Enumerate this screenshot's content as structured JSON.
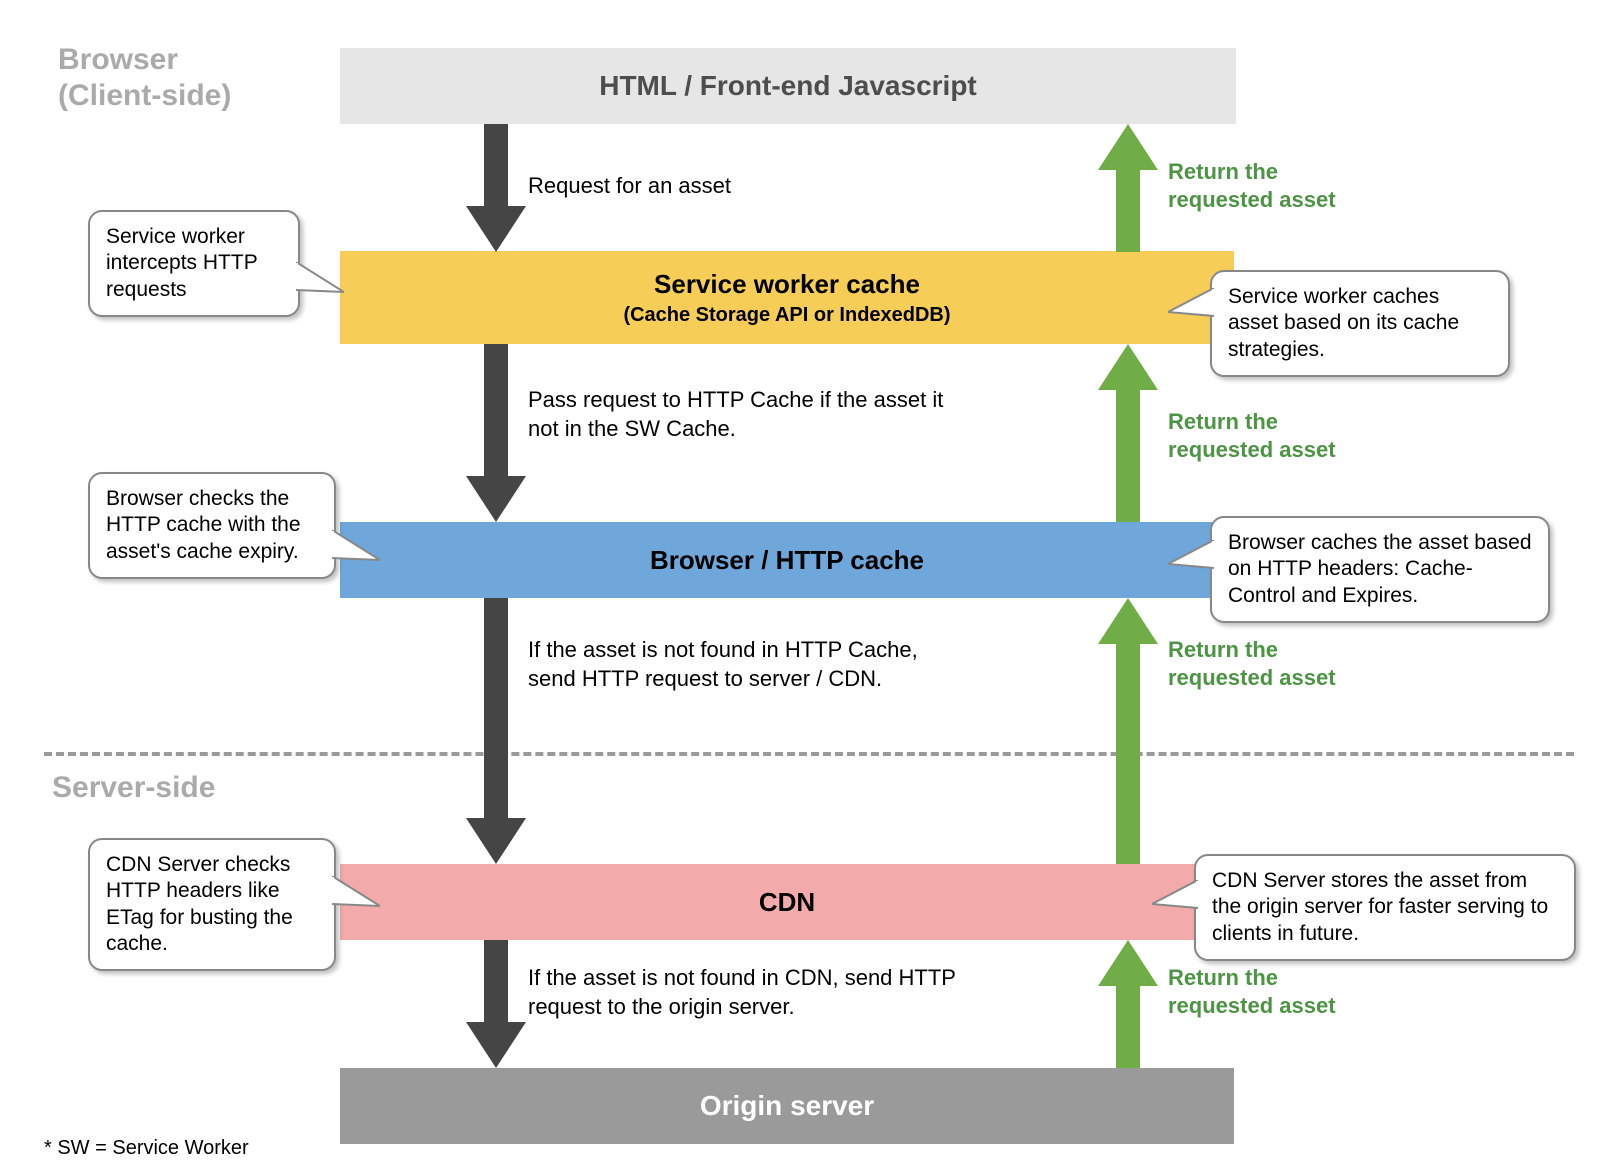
{
  "sections": {
    "browser_line1": "Browser",
    "browser_line2": "(Client-side)",
    "server": "Server-side"
  },
  "layers": {
    "html": "HTML / Front-end Javascript",
    "sw_title": "Service worker cache",
    "sw_sub": "(Cache Storage API or IndexedDB)",
    "http": "Browser / HTTP cache",
    "cdn": "CDN",
    "origin": "Origin server"
  },
  "down": {
    "d1": "Request for an asset",
    "d2": "Pass request to HTTP Cache if the asset it not in the SW Cache.",
    "d3": "If the asset is not found in HTTP Cache, send HTTP request to server / CDN.",
    "d4": "If the asset is not found in CDN, send HTTP request to the origin server."
  },
  "up": {
    "u1": "Return the requested asset",
    "u2": "Return the requested asset",
    "u3": "Return the requested asset",
    "u4": "Return the requested asset"
  },
  "callouts": {
    "c1": "Service worker intercepts HTTP requests",
    "c2": "Browser checks the HTTP cache with the asset's cache expiry.",
    "c3": "CDN Server checks HTTP headers like ETag for busting the cache.",
    "c4": "Service worker caches asset based on its cache strategies.",
    "c5": "Browser caches the asset based on HTTP headers: Cache-Control and Expires.",
    "c6": "CDN Server stores the asset from the origin server for faster serving to clients in future."
  },
  "footnote": "* SW = Service Worker"
}
